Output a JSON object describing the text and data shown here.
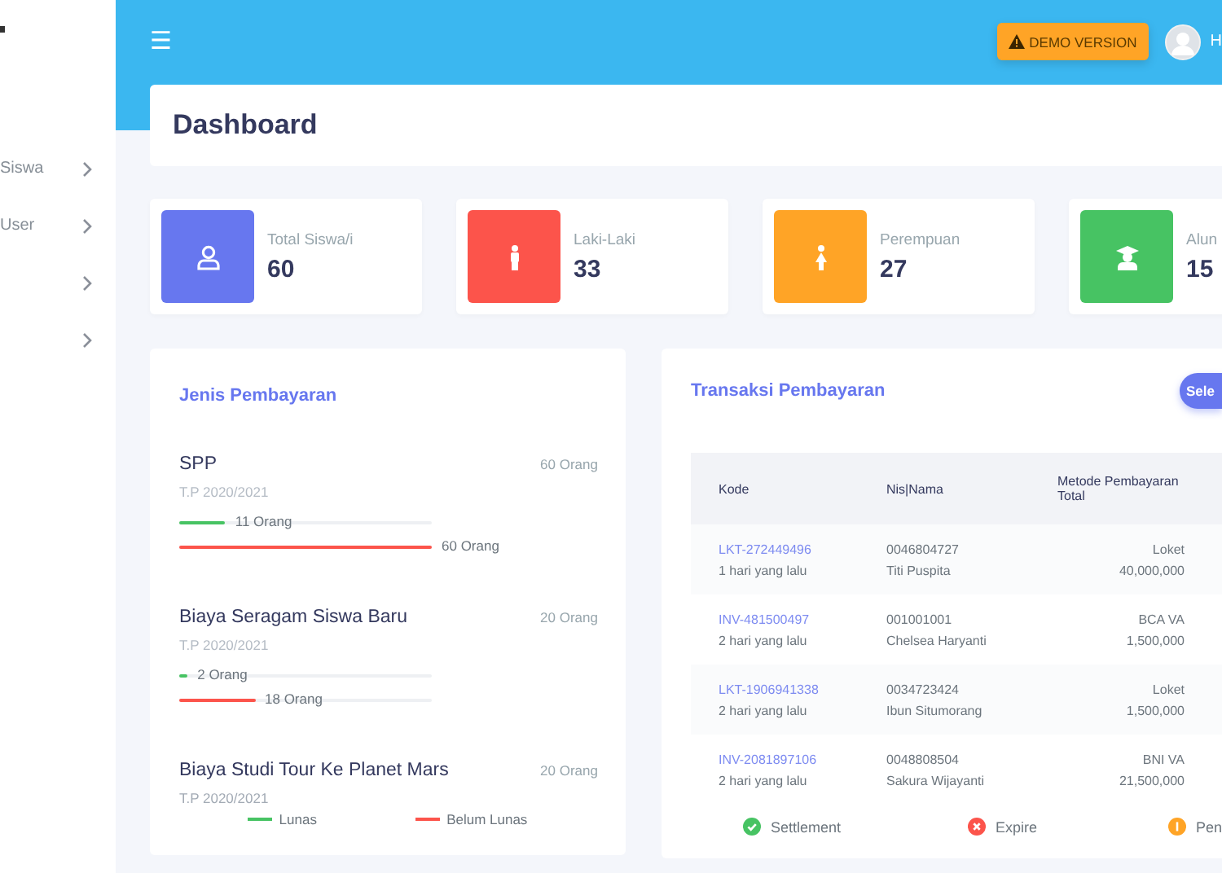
{
  "sidebar": {
    "items": [
      {
        "label": "Siswa",
        "expandable": true
      },
      {
        "label": "User",
        "expandable": true
      },
      {
        "expandable": true
      },
      {
        "expandable": true
      }
    ]
  },
  "header": {
    "menu_icon": "☰",
    "demo_badge": "DEMO VERSION",
    "user_name": "H"
  },
  "page_title": "Dashboard",
  "stats": [
    {
      "kind": "user",
      "label": "Total Siswa/i",
      "value": "60",
      "color": "#6777ef"
    },
    {
      "kind": "male",
      "label": "Laki-Laki",
      "value": "33",
      "color": "#fc544b"
    },
    {
      "kind": "female",
      "label": "Perempuan",
      "value": "27",
      "color": "#ffa426"
    },
    {
      "kind": "graduate",
      "label": "Alun",
      "value": "15",
      "color": "#47c363"
    }
  ],
  "payment_types": {
    "title": "Jenis Pembayaran",
    "items": [
      {
        "name": "SPP",
        "period": "T.P 2020/2021",
        "total": "60 Orang",
        "paid": {
          "level": 0.183,
          "label": "11 Orang"
        },
        "unpaid": {
          "level": 1,
          "label": "60 Orang"
        }
      },
      {
        "name": "Biaya Seragam Siswa Baru",
        "period": "T.P 2020/2021",
        "total": "20 Orang",
        "paid": {
          "level": 0.033,
          "label": "2 Orang"
        },
        "unpaid": {
          "level": 0.3,
          "label": "18 Orang"
        }
      },
      {
        "name": "Biaya Studi Tour Ke Planet Mars",
        "period": "T.P 2020/2021",
        "total": "20 Orang"
      }
    ],
    "legend": [
      {
        "label": "Lunas",
        "color": "#47c363"
      },
      {
        "label": "Belum Lunas",
        "color": "#fc544b"
      }
    ]
  },
  "transactions": {
    "title": "Transaksi Pembayaran",
    "button": "Sele",
    "columns": [
      "Kode",
      "Nis|Nama",
      "Metode Pembayaran",
      "Total"
    ],
    "rows": [
      {
        "code": "LKT-272449496",
        "time": "1 hari yang lalu",
        "nis": "0046804727",
        "name": "Titi Puspita",
        "method": "Loket",
        "total": "40,000,000"
      },
      {
        "code": "INV-481500497",
        "time": "2 hari yang lalu",
        "nis": "001001001",
        "name": "Chelsea Haryanti",
        "method": "BCA VA",
        "total": "1,500,000"
      },
      {
        "code": "LKT-1906941338",
        "time": "2 hari yang lalu",
        "nis": "0034723424",
        "name": "Ibun Situmorang",
        "method": "Loket",
        "total": "1,500,000"
      },
      {
        "code": "INV-2081897106",
        "time": "2 hari yang lalu",
        "nis": "0048808504",
        "name": "Sakura Wijayanti",
        "method": "BNI VA",
        "total": "21,500,000"
      }
    ],
    "statuses": [
      {
        "kind": "settlement",
        "label": "Settlement",
        "color": "#47c363"
      },
      {
        "kind": "expire",
        "label": "Expire",
        "color": "#fc544b"
      },
      {
        "kind": "pending",
        "label": "Pen",
        "color": "#ffa426"
      }
    ]
  }
}
